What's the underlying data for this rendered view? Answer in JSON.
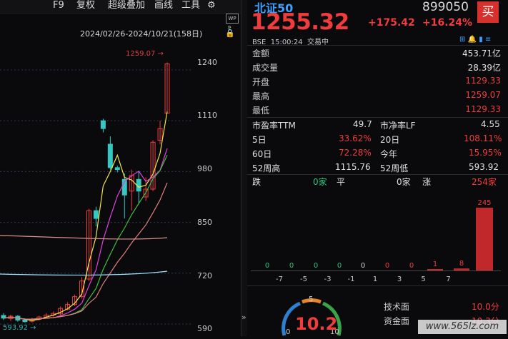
{
  "toolbar": {
    "f9": "F9",
    "fuquan": "复权",
    "overlay": "超级叠加",
    "draw": "画线",
    "tools": "工具",
    "wp": "WP"
  },
  "chart": {
    "date_range": "2024/02/26-2024/10/21(158日)",
    "high_label": "1259.07",
    "low_label": "593.92",
    "y_ticks": [
      "1240",
      "1110",
      "980",
      "850",
      "720",
      "590"
    ]
  },
  "chart_data": {
    "type": "candlestick",
    "ylim": [
      590,
      1260
    ],
    "y_ticks": [
      590,
      720,
      850,
      980,
      1110,
      1240
    ],
    "candles": [
      {
        "o": 612,
        "c": 605,
        "h": 618,
        "l": 600,
        "up": false
      },
      {
        "o": 604,
        "c": 610,
        "h": 614,
        "l": 598,
        "up": true
      },
      {
        "o": 610,
        "c": 600,
        "h": 613,
        "l": 596,
        "up": false
      },
      {
        "o": 600,
        "c": 596,
        "h": 604,
        "l": 594,
        "up": false
      },
      {
        "o": 597,
        "c": 602,
        "h": 606,
        "l": 594,
        "up": true
      },
      {
        "o": 602,
        "c": 608,
        "h": 611,
        "l": 599,
        "up": true
      },
      {
        "o": 608,
        "c": 613,
        "h": 618,
        "l": 604,
        "up": true
      },
      {
        "o": 613,
        "c": 617,
        "h": 622,
        "l": 609,
        "up": true
      },
      {
        "o": 616,
        "c": 630,
        "h": 635,
        "l": 612,
        "up": true
      },
      {
        "o": 628,
        "c": 640,
        "h": 646,
        "l": 625,
        "up": true
      },
      {
        "o": 640,
        "c": 660,
        "h": 665,
        "l": 636,
        "up": true
      },
      {
        "o": 660,
        "c": 700,
        "h": 710,
        "l": 655,
        "up": true
      },
      {
        "o": 705,
        "c": 880,
        "h": 885,
        "l": 700,
        "up": true
      },
      {
        "o": 880,
        "c": 860,
        "h": 890,
        "l": 840,
        "up": false
      },
      {
        "o": 1110,
        "c": 1090,
        "h": 1115,
        "l": 1080,
        "up": false
      },
      {
        "o": 1050,
        "c": 990,
        "h": 1070,
        "l": 985,
        "up": false
      },
      {
        "o": 990,
        "c": 985,
        "h": 995,
        "l": 978,
        "up": false
      },
      {
        "o": 960,
        "c": 920,
        "h": 975,
        "l": 860,
        "up": false
      },
      {
        "o": 930,
        "c": 970,
        "h": 985,
        "l": 880,
        "up": true
      },
      {
        "o": 960,
        "c": 930,
        "h": 980,
        "l": 900,
        "up": false
      },
      {
        "o": 915,
        "c": 935,
        "h": 965,
        "l": 905,
        "up": true
      },
      {
        "o": 935,
        "c": 1055,
        "h": 1060,
        "l": 930,
        "up": true
      },
      {
        "o": 1060,
        "c": 1090,
        "h": 1110,
        "l": 1050,
        "up": true
      },
      {
        "o": 1129.33,
        "c": 1255.32,
        "h": 1259.07,
        "l": 1129.33,
        "up": true
      }
    ]
  },
  "quote": {
    "name": "北证50",
    "code": "899050",
    "buy": "买",
    "price": "1255.32",
    "change": "+175.42",
    "change_pct": "+16.24%",
    "market": "BSE",
    "time": "15:00:24",
    "status": "交易中"
  },
  "stats": [
    {
      "label": "金额",
      "value": "453.71亿",
      "color": "w"
    },
    {
      "label": "成交量",
      "value": "28.39亿",
      "color": "w"
    },
    {
      "label": "开盘",
      "value": "1129.33",
      "color": "r"
    },
    {
      "label": "最高",
      "value": "1259.07",
      "color": "r"
    },
    {
      "label": "最低",
      "value": "1129.33",
      "color": "r"
    }
  ],
  "metrics": {
    "pe_label": "市盈率TTM",
    "pe_value": "49.7",
    "pb_label": "市净率LF",
    "pb_value": "4.55",
    "d5_label": "5日",
    "d5_value": "33.62%",
    "d20_label": "20日",
    "d20_value": "108.11%",
    "d60_label": "60日",
    "d60_value": "72.28%",
    "ytd_label": "今年",
    "ytd_value": "15.95%",
    "w52h_label": "52周高",
    "w52h_value": "1115.76",
    "w52l_label": "52周低",
    "w52l_value": "593.92"
  },
  "breadth": {
    "down_label": "跌",
    "down_value": "0家",
    "flat_label": "平",
    "flat_value": "0家",
    "up_label": "涨",
    "up_value": "254家"
  },
  "distribution": {
    "bins": [
      "-7",
      "-5",
      "-3",
      "-1",
      "1",
      "3",
      "5",
      "7"
    ],
    "counts": [
      0,
      0,
      0,
      0,
      0,
      0,
      0,
      1,
      8,
      245
    ]
  },
  "gauge": {
    "score": "10.2",
    "tick_top": "5",
    "tick_left": "0",
    "tick_right": "10",
    "tech_label": "技术面",
    "tech_value": "10.0分",
    "fund_label": "资金面",
    "fund_value": "10.3分"
  },
  "watermark": "www.565lz.com"
}
